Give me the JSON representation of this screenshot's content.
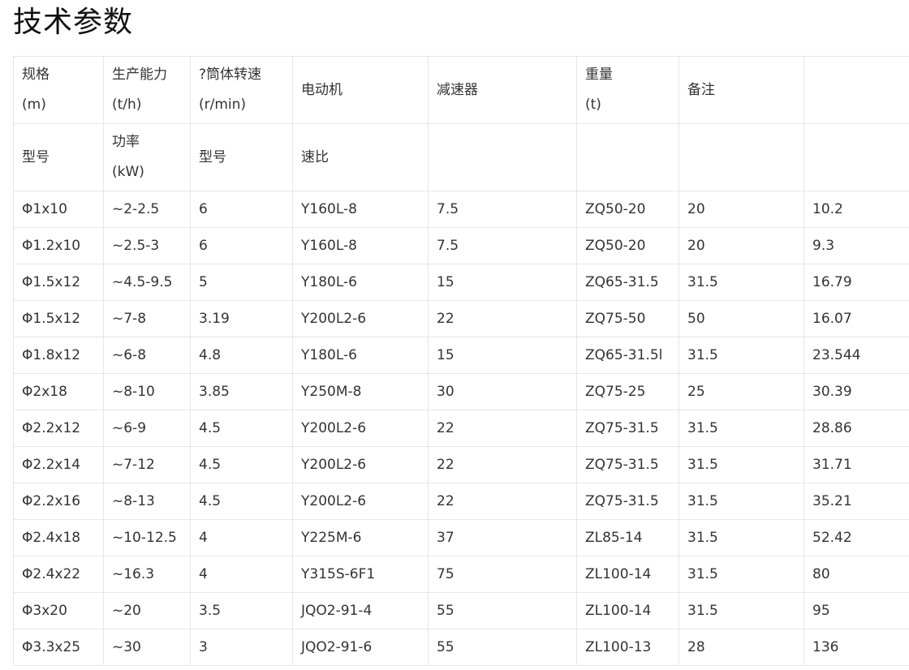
{
  "page_title": "技术参数",
  "header_rows": [
    [
      {
        "line1": "规格",
        "line2": "(m)"
      },
      {
        "line1": "生产能力",
        "line2": "(t/h)"
      },
      {
        "line1": "?筒体转速",
        "line2": "(r/min)"
      },
      {
        "line1": "电动机",
        "line2": ""
      },
      {
        "line1": "减速器",
        "line2": ""
      },
      {
        "line1": "重量",
        "line2": "(t)"
      },
      {
        "line1": "备注",
        "line2": ""
      },
      {
        "line1": "",
        "line2": ""
      }
    ],
    [
      {
        "line1": "型号",
        "line2": ""
      },
      {
        "line1": "功率",
        "line2": "(kW)"
      },
      {
        "line1": "型号",
        "line2": ""
      },
      {
        "line1": "速比",
        "line2": ""
      },
      {
        "line1": "",
        "line2": ""
      },
      {
        "line1": "",
        "line2": ""
      },
      {
        "line1": "",
        "line2": ""
      },
      {
        "line1": "",
        "line2": ""
      }
    ]
  ],
  "rows": [
    [
      "Φ1x10",
      "~2-2.5",
      "6",
      "Y160L-8",
      "7.5",
      "ZQ50-20",
      "20",
      "10.2"
    ],
    [
      "Φ1.2x10",
      "~2.5-3",
      "6",
      "Y160L-8",
      "7.5",
      "ZQ50-20",
      "20",
      "9.3"
    ],
    [
      "Φ1.5x12",
      "~4.5-9.5",
      "5",
      "Y180L-6",
      "15",
      "ZQ65-31.5",
      "31.5",
      "16.79"
    ],
    [
      "Φ1.5x12",
      "~7-8",
      "3.19",
      "Y200L2-6",
      "22",
      "ZQ75-50",
      "50",
      "16.07"
    ],
    [
      "Φ1.8x12",
      "~6-8",
      "4.8",
      "Y180L-6",
      "15",
      "ZQ65-31.5l",
      "31.5",
      "23.544"
    ],
    [
      "Φ2x18",
      "~8-10",
      "3.85",
      "Y250M-8",
      "30",
      "ZQ75-25",
      "25",
      "30.39"
    ],
    [
      "Φ2.2x12",
      "~6-9",
      "4.5",
      "Y200L2-6",
      "22",
      "ZQ75-31.5",
      "31.5",
      "28.86"
    ],
    [
      "Φ2.2x14",
      "~7-12",
      "4.5",
      "Y200L2-6",
      "22",
      "ZQ75-31.5",
      "31.5",
      "31.71"
    ],
    [
      "Φ2.2x16",
      "~8-13",
      "4.5",
      "Y200L2-6",
      "22",
      "ZQ75-31.5",
      "31.5",
      "35.21"
    ],
    [
      "Φ2.4x18",
      "~10-12.5",
      "4",
      "Y225M-6",
      "37",
      "ZL85-14",
      "31.5",
      "52.42"
    ],
    [
      "Φ2.4x22",
      "~16.3",
      "4",
      "Y315S-6F1",
      "75",
      "ZL100-14",
      "31.5",
      "80"
    ],
    [
      "Φ3x20",
      "~20",
      "3.5",
      "JQO2-91-4",
      "55",
      "ZL100-14",
      "31.5",
      "95"
    ],
    [
      "Φ3.3x25",
      "~30",
      "3",
      "JQO2-91-6",
      "55",
      "ZL100-13",
      "28",
      "136"
    ]
  ]
}
